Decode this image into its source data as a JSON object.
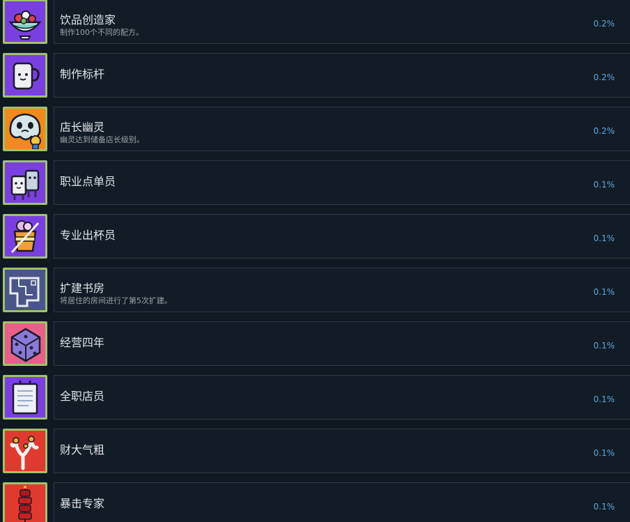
{
  "achievements": [
    {
      "title": "饮品创造家",
      "desc": "制作100个不同的配方。",
      "pct": "0.2%",
      "icon": "salad-bowl-icon",
      "bg": "#7a3fe0"
    },
    {
      "title": "制作标杆",
      "desc": "",
      "pct": "0.2%",
      "icon": "mug-icon",
      "bg": "#7a3fe0"
    },
    {
      "title": "店长幽灵",
      "desc": "幽灵达到储备店长级别。",
      "pct": "0.2%",
      "icon": "ghost-icon",
      "bg": "#f08a1e"
    },
    {
      "title": "职业点单员",
      "desc": "",
      "pct": "0.1%",
      "icon": "cups-icon",
      "bg": "#7a3fe0"
    },
    {
      "title": "专业出杯员",
      "desc": "",
      "pct": "0.1%",
      "icon": "drink-cup-icon",
      "bg": "#7a3fe0"
    },
    {
      "title": "扩建书房",
      "desc": "将居住的房间进行了第5次扩建。",
      "pct": "0.1%",
      "icon": "floorplan-icon",
      "bg": "#4a5588"
    },
    {
      "title": "经营四年",
      "desc": "",
      "pct": "0.1%",
      "icon": "dice-icon",
      "bg": "#e8608a"
    },
    {
      "title": "全职店员",
      "desc": "",
      "pct": "0.1%",
      "icon": "notepad-icon",
      "bg": "#7a3fe0"
    },
    {
      "title": "财大气粗",
      "desc": "",
      "pct": "0.1%",
      "icon": "coral-icon",
      "bg": "#e03a30"
    },
    {
      "title": "暴击专家",
      "desc": "",
      "pct": "0.1%",
      "icon": "firecracker-icon",
      "bg": "#e03a30"
    }
  ]
}
